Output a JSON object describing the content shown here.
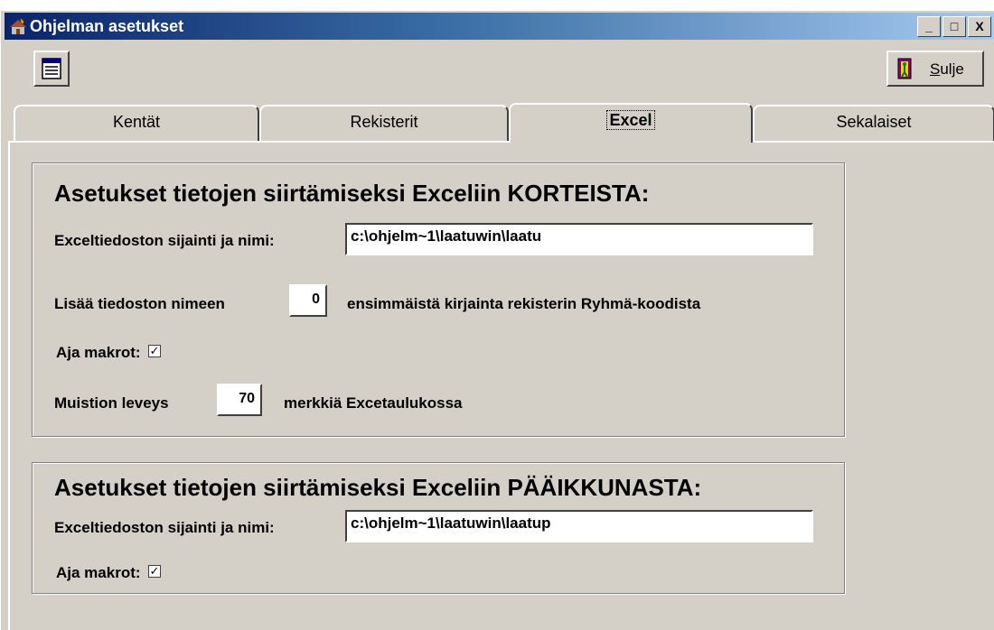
{
  "window": {
    "title": "Ohjelman asetukset",
    "controls": {
      "minimize": "_",
      "maximize": "□",
      "close": "X"
    }
  },
  "toolbar": {
    "close_label": "Sulje",
    "close_mnemonic": "S",
    "close_rest": "ulje",
    "left_icon": "form-icon",
    "close_icon": "exit-door-icon"
  },
  "tabs": [
    {
      "label": "Kentät"
    },
    {
      "label": "Rekisterit"
    },
    {
      "label": "Excel",
      "active": true
    },
    {
      "label": "Sekalaiset"
    }
  ],
  "cards_group": {
    "heading": "Asetukset tietojen siirtämiseksi Exceliin KORTEISTA:",
    "file_label": "Exceltiedoston sijainti ja nimi:",
    "file_value": "c:\\ohjelm~1\\laatuwin\\laatu",
    "prefix_label_before": "Lisää tiedoston nimeen",
    "prefix_value": "0",
    "prefix_label_after": "ensimmäistä kirjainta rekisterin Ryhmä-koodista",
    "macros_label": "Aja makrot:",
    "macros_checked": "✓",
    "memo_label_before": "Muistion leveys",
    "memo_value": "70",
    "memo_label_after": "merkkiä Excetaulukossa"
  },
  "main_group": {
    "heading": "Asetukset tietojen siirtämiseksi Exceliin PÄÄIKKUNASTA:",
    "file_label": "Exceltiedoston sijainti ja nimi:",
    "file_value": "c:\\ohjelm~1\\laatuwin\\laatup",
    "macros_label": "Aja makrot:",
    "macros_checked": "✓"
  },
  "colors": {
    "titlebar_start": "#0a246a",
    "titlebar_end": "#a6caf0",
    "face": "#d4d0c8"
  }
}
